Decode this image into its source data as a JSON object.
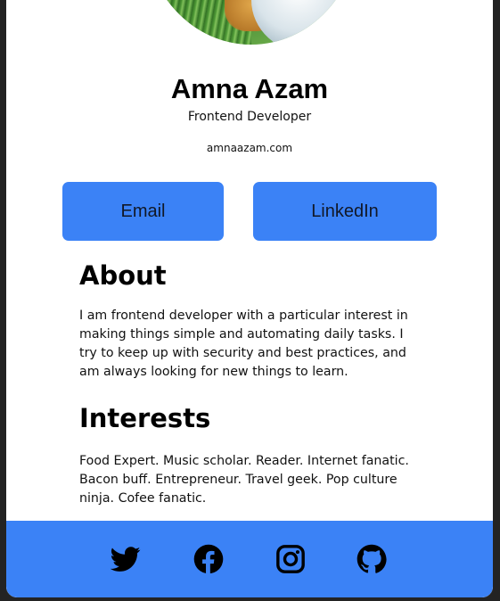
{
  "profile": {
    "name": "Amna Azam",
    "role": "Frontend Developer",
    "website": "amnaazam.com"
  },
  "buttons": {
    "email": "Email",
    "linkedin": "LinkedIn"
  },
  "about": {
    "heading": "About",
    "text": "I am frontend developer with a particular interest in making things simple and automating daily tasks. I try to keep up with security and best practices, and am always looking for new things to learn."
  },
  "interests": {
    "heading": "Interests",
    "text": "Food Expert. Music scholar. Reader. Internet fanatic. Bacon buff. Entrepreneur. Travel geek. Pop culture ninja. Cofee fanatic."
  },
  "footer": {
    "social_icons": [
      "twitter-icon",
      "facebook-icon",
      "instagram-icon",
      "github-icon"
    ]
  },
  "colors": {
    "accent": "#3b82f6",
    "card_background": "#ffffff",
    "page_background": "#232323"
  }
}
